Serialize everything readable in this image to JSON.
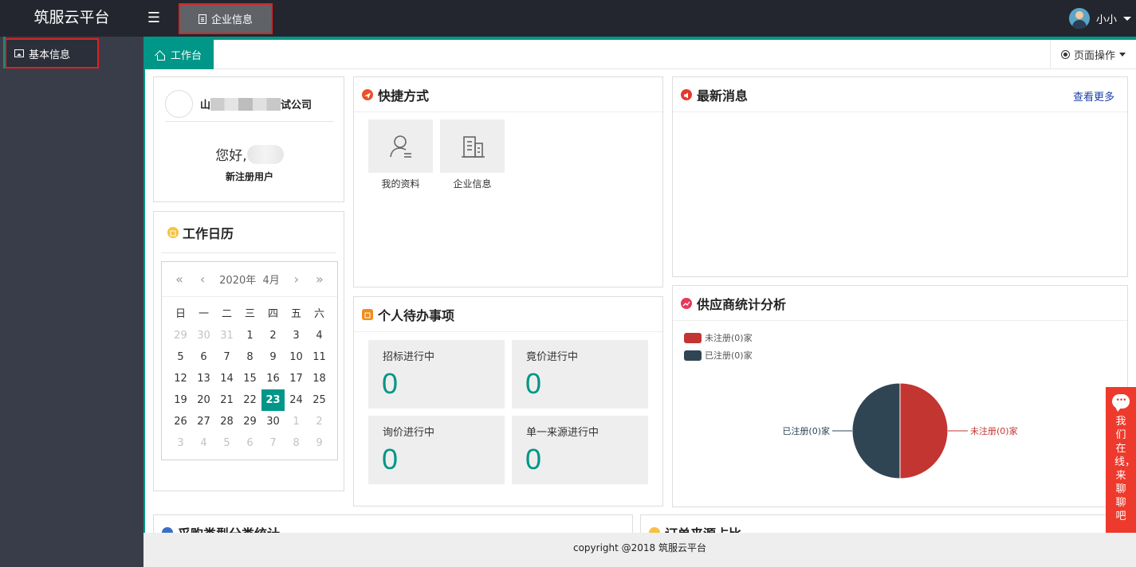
{
  "app": {
    "title": "筑服云平台"
  },
  "header": {
    "tab_label": "企业信息",
    "user_name": "小小"
  },
  "sidebar": {
    "items": [
      {
        "label": "基本信息"
      }
    ]
  },
  "tabbar": {
    "home_label": "工作台",
    "page_ops_label": "页面操作"
  },
  "company": {
    "name_prefix": "山",
    "name_suffix": "试公司",
    "greeting": "您好,",
    "role": "新注册用户"
  },
  "shortcuts": {
    "title": "快捷方式",
    "items": [
      {
        "label": "我的资料",
        "icon": "user-icon"
      },
      {
        "label": "企业信息",
        "icon": "building-icon"
      }
    ]
  },
  "news": {
    "title": "最新消息",
    "more_label": "查看更多"
  },
  "calendar": {
    "title": "工作日历",
    "year_label": "2020年",
    "month_label": "4月",
    "weekdays": [
      "日",
      "一",
      "二",
      "三",
      "四",
      "五",
      "六"
    ],
    "days": [
      [
        "29",
        "30",
        "31",
        "1",
        "2",
        "3",
        "4"
      ],
      [
        "5",
        "6",
        "7",
        "8",
        "9",
        "10",
        "11"
      ],
      [
        "12",
        "13",
        "14",
        "15",
        "16",
        "17",
        "18"
      ],
      [
        "19",
        "20",
        "21",
        "22",
        "23",
        "24",
        "25"
      ],
      [
        "26",
        "27",
        "28",
        "29",
        "30",
        "1",
        "2"
      ],
      [
        "3",
        "4",
        "5",
        "6",
        "7",
        "8",
        "9"
      ]
    ],
    "today": "23"
  },
  "todo": {
    "title": "个人待办事项",
    "items": [
      {
        "label": "招标进行中",
        "value": "0"
      },
      {
        "label": "竟价进行中",
        "value": "0"
      },
      {
        "label": "询价进行中",
        "value": "0"
      },
      {
        "label": "单一来源进行中",
        "value": "0"
      }
    ]
  },
  "chart_data": {
    "type": "pie",
    "title": "供应商统计分析",
    "legend": [
      "未注册(0)家",
      "已注册(0)家"
    ],
    "values": [
      0,
      0
    ],
    "slice_labels": [
      "未注册(0)家",
      "已注册(0)家"
    ],
    "colors": [
      "#c23531",
      "#2f4554"
    ]
  },
  "bottom": {
    "left_title": "采购类型分类统计",
    "right_title": "订单来源占比"
  },
  "footer": {
    "text": "copyright @2018 筑服云平台"
  },
  "chat": {
    "label": "我们在线，来聊聊吧"
  },
  "colors": {
    "accent": "#009688",
    "topbar": "#23262e",
    "sidebar": "#393d49",
    "highlight": "#e02020"
  }
}
